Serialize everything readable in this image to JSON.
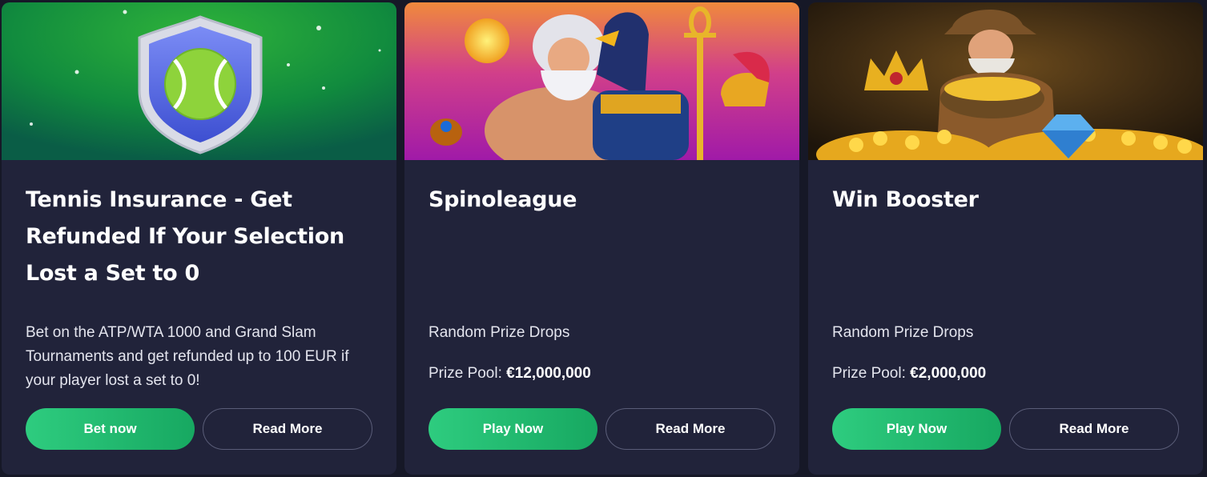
{
  "cards": [
    {
      "title": "Tennis Insurance - Get Refunded If Your Selection Lost a Set to 0",
      "description": "Bet on the ATP/WTA 1000 and Grand Slam Tournaments and get refunded up to 100 EUR if your player lost a set to 0!",
      "primary_button": "Bet now",
      "secondary_button": "Read More",
      "banner_icon": "tennis-shield-icon"
    },
    {
      "title": "Spinoleague",
      "description": "Random Prize Drops",
      "prize_label": "Prize Pool:",
      "prize_value": "€12,000,000",
      "primary_button": "Play Now",
      "secondary_button": "Read More",
      "banner_icon": "gods-artwork"
    },
    {
      "title": "Win Booster",
      "description": "Random Prize Drops",
      "prize_label": "Prize Pool:",
      "prize_value": "€2,000,000",
      "primary_button": "Play Now",
      "secondary_button": "Read More",
      "banner_icon": "treasure-artwork"
    }
  ],
  "colors": {
    "background": "#161827",
    "card": "#21233a",
    "primary_button": "#22bb70",
    "secondary_border": "#5a5d78"
  }
}
